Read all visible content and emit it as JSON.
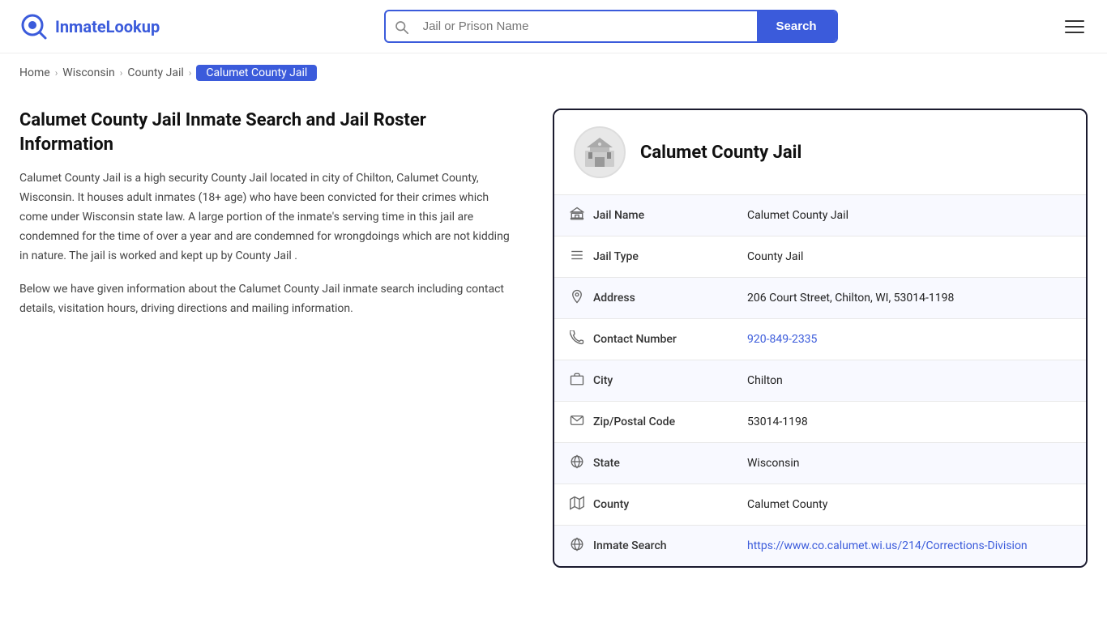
{
  "header": {
    "logo_text_part1": "Inmate",
    "logo_text_part2": "Lookup",
    "search_placeholder": "Jail or Prison Name",
    "search_button_label": "Search"
  },
  "breadcrumb": {
    "home": "Home",
    "state": "Wisconsin",
    "type": "County Jail",
    "current": "Calumet County Jail"
  },
  "left": {
    "title": "Calumet County Jail Inmate Search and Jail Roster Information",
    "description": "Calumet County Jail is a high security County Jail located in city of Chilton, Calumet County, Wisconsin. It houses adult inmates (18+ age) who have been convicted for their crimes which come under Wisconsin state law. A large portion of the inmate's serving time in this jail are condemned for the time of over a year and are condemned for wrongdoings which are not kidding in nature. The jail is worked and kept up by County Jail .",
    "description2": "Below we have given information about the Calumet County Jail inmate search including contact details, visitation hours, driving directions and mailing information."
  },
  "card": {
    "title": "Calumet County Jail",
    "rows": [
      {
        "label": "Jail Name",
        "value": "Calumet County Jail",
        "link": null,
        "icon": "🏛"
      },
      {
        "label": "Jail Type",
        "value": "County Jail",
        "link": "#",
        "icon": "≡"
      },
      {
        "label": "Address",
        "value": "206 Court Street, Chilton, WI, 53014-1198",
        "link": null,
        "icon": "📍"
      },
      {
        "label": "Contact Number",
        "value": "920-849-2335",
        "link": "tel:920-849-2335",
        "icon": "📞"
      },
      {
        "label": "City",
        "value": "Chilton",
        "link": null,
        "icon": "🏙"
      },
      {
        "label": "Zip/Postal Code",
        "value": "53014-1198",
        "link": null,
        "icon": "✉"
      },
      {
        "label": "State",
        "value": "Wisconsin",
        "link": "#",
        "icon": "🌐"
      },
      {
        "label": "County",
        "value": "Calumet County",
        "link": null,
        "icon": "🗺"
      },
      {
        "label": "Inmate Search",
        "value": "https://www.co.calumet.wi.us/214/Corrections-Division",
        "link": "https://www.co.calumet.wi.us/214/Corrections-Division",
        "icon": "🌐"
      }
    ]
  }
}
